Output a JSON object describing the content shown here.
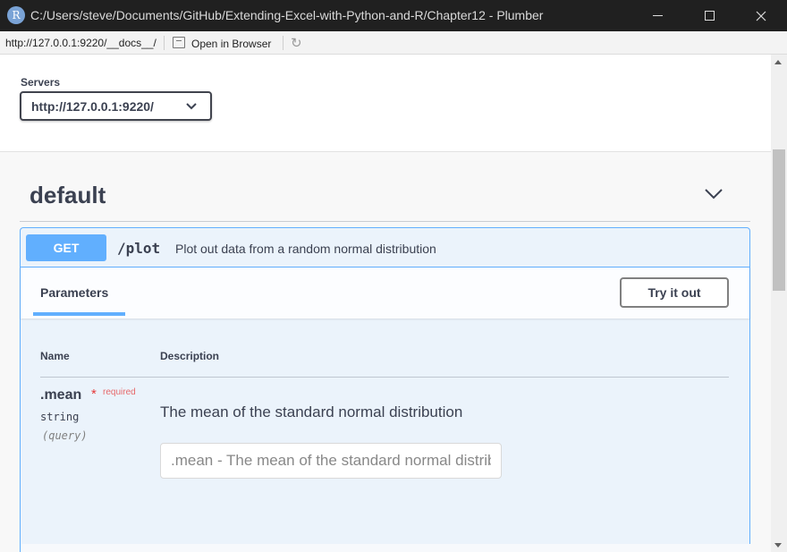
{
  "window": {
    "app_icon_letter": "R",
    "title": "C:/Users/steve/Documents/GitHub/Extending-Excel-with-Python-and-R/Chapter12 - Plumber"
  },
  "toolbar": {
    "url": "http://127.0.0.1:9220/__docs__/",
    "open_in_browser": "Open in Browser"
  },
  "servers": {
    "label": "Servers",
    "selected": "http://127.0.0.1:9220/"
  },
  "tag": {
    "name": "default"
  },
  "operation": {
    "method": "GET",
    "path": "/plot",
    "summary": "Plot out data from a random normal distribution",
    "parameters_tab": "Parameters",
    "try_it_out": "Try it out",
    "columns": {
      "name": "Name",
      "description": "Description"
    },
    "parameters": [
      {
        "name": ".mean",
        "required_mark": "*",
        "required_text": "required",
        "type": "string",
        "in": "(query)",
        "description": "The mean of the standard normal distribution",
        "placeholder": ".mean - The mean of the standard normal distribution"
      }
    ]
  },
  "colors": {
    "get_accent": "#61affe",
    "opblock_bg": "#ebf3fb",
    "text": "#3b4151",
    "required": "#e53a3a"
  }
}
